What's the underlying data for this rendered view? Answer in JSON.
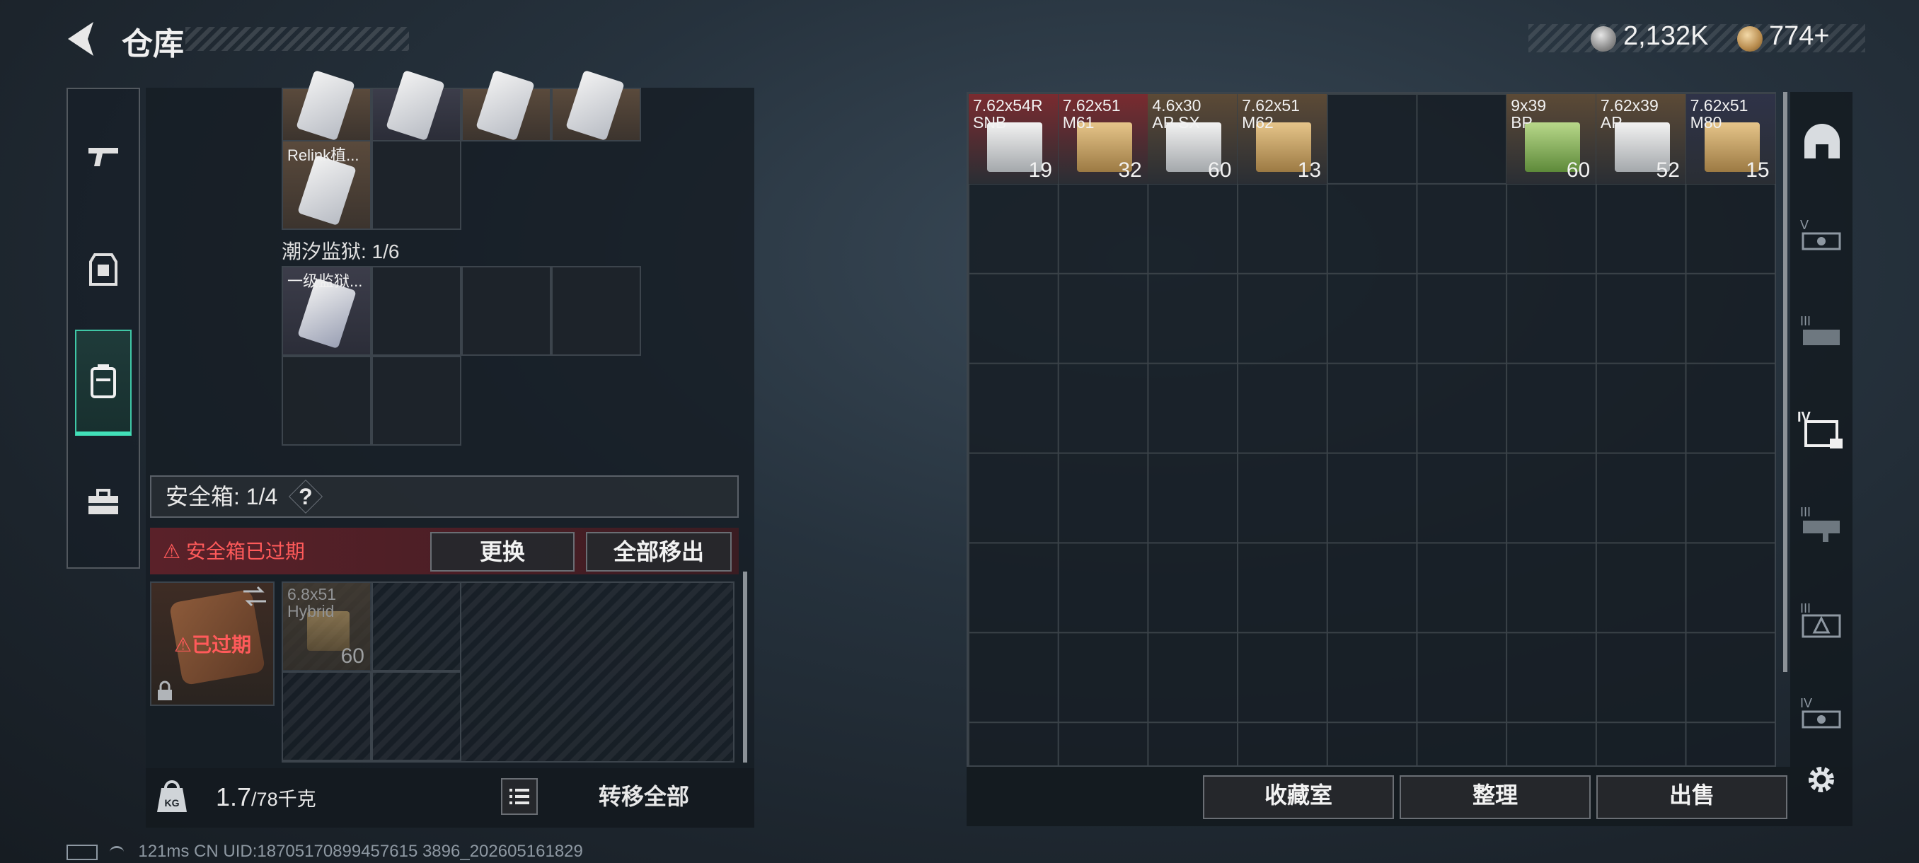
{
  "header": {
    "title": "仓库"
  },
  "currency": {
    "silver": "2,132K",
    "gold": "774+"
  },
  "nav": {
    "items": [
      "weapon-icon",
      "armor-icon",
      "backpack-icon",
      "toolbox-icon"
    ]
  },
  "left": {
    "items": [
      {
        "name": "Relink植..."
      },
      {
        "name": "一级监狱..."
      }
    ],
    "section_tidal": "潮汐监狱: 1/6",
    "safe_label": "安全箱: 1/4",
    "safe_help": "?",
    "expired_warning": "安全箱已过期",
    "replace_label": "更换",
    "move_all_label": "全部移出",
    "case_expired": "已过期",
    "safe_item": {
      "name": "6.8x51\nHybrid",
      "count": "60"
    },
    "weight_value": "1.7",
    "weight_max": "/78千克",
    "transfer_all": "转移全部",
    "status": "121ms    CN UID:18705170899457615 3896_202605161829"
  },
  "stash": {
    "items": [
      {
        "name": "7.62x54R\nSNB",
        "count": "19",
        "col": 0,
        "color": "#7a2b30"
      },
      {
        "name": "7.62x51\nM61",
        "count": "32",
        "col": 1,
        "color": "#7a2b30"
      },
      {
        "name": "4.6x30\nAP SX",
        "count": "60",
        "col": 2,
        "color": "#5c4a36"
      },
      {
        "name": "7.62x51\nM62",
        "count": "13",
        "col": 3,
        "color": "#5c4a36"
      },
      {
        "name": "9x39\nBP",
        "count": "60",
        "col": 6,
        "color": "#5c4a36"
      },
      {
        "name": "7.62x39\nAP",
        "count": "52",
        "col": 7,
        "color": "#5c4a36"
      },
      {
        "name": "7.62x51\nM80",
        "count": "15",
        "col": 8,
        "color": "#2f3348"
      }
    ],
    "collection_label": "收藏室",
    "sort_label": "整理",
    "sell_label": "出售"
  },
  "rail": {
    "items": [
      "helmet-icon",
      "tier-v-gun-icon",
      "tier-iii-gun-icon",
      "tier-iv-case-icon",
      "tier-iii-gun2-icon",
      "tier-iii-ammo-icon",
      "tier-iv-gun-icon",
      "settings-icon"
    ]
  }
}
